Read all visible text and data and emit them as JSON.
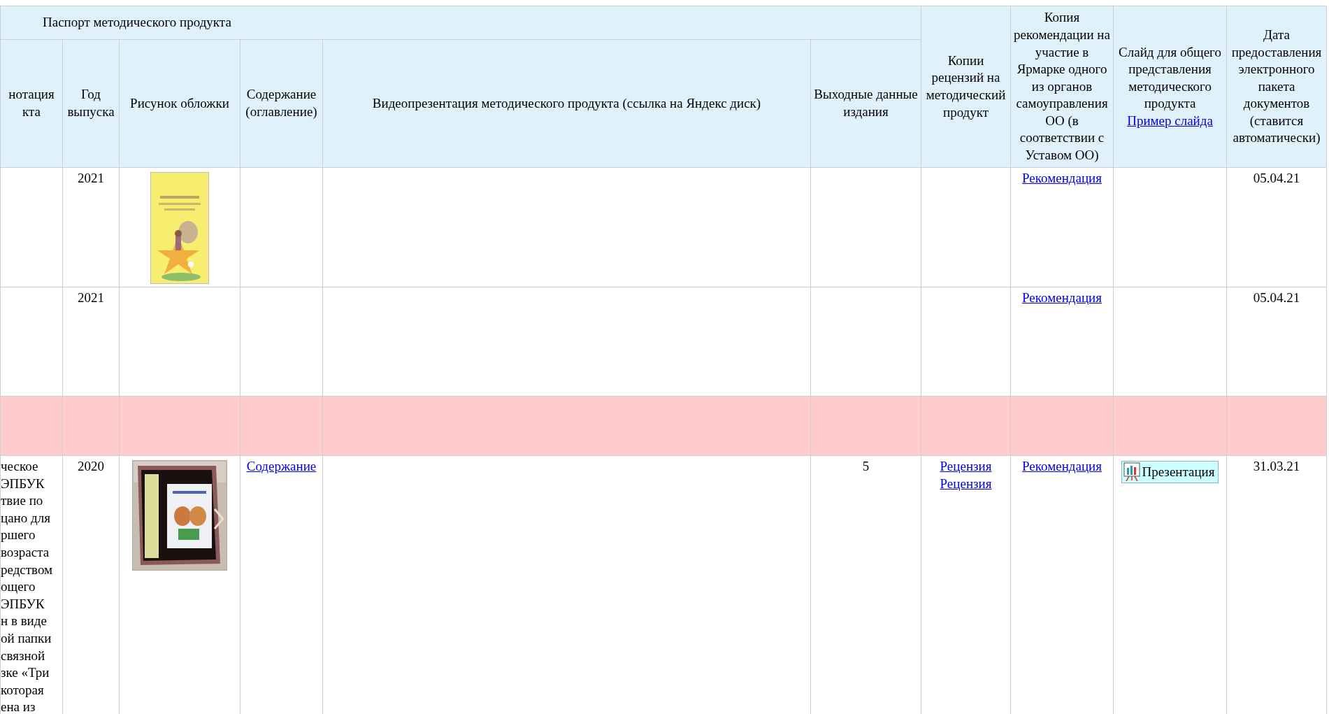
{
  "table": {
    "group_title": "Паспорт методического продукта",
    "columns": [
      {
        "label": "нотация\nкта"
      },
      {
        "label": "Год выпуска"
      },
      {
        "label": "Рисунок обложки"
      },
      {
        "label": "Содержание (оглавление)"
      },
      {
        "label": "Видеопрезентация методического продукта (ссылка на Яндекс диск)"
      },
      {
        "label": "Выходные данные издания"
      },
      {
        "label": "Копии рецензий на методический продукт"
      },
      {
        "label": "Копия рекомендации на участие в Ярмарке одного из органов самоуправления ОО (в соответствии с Уставом ОО)"
      },
      {
        "label": "Слайд для общего представления методического продукта",
        "link": "Пример слайда"
      },
      {
        "label": "Дата предоставления электронного пакета документов (ставится автоматически)"
      }
    ],
    "rows": [
      {
        "highlighted": false,
        "year": "2021",
        "recommendation": "Рекомендация",
        "date": "05.04.21"
      },
      {
        "highlighted": false,
        "year": "2021",
        "recommendation": "Рекомендация",
        "date": "05.04.21"
      },
      {
        "highlighted": true
      },
      {
        "highlighted": false,
        "annotation": "ческое\nЭПБУК\nтвие по\nцано для\nршего\nвозраста\nредством\nощего\nЭПБУК\nн в виде\nой папки\nсвязной\nзке «Три\nкоторая\nена из",
        "year": "2020",
        "contents": "Содержание",
        "output": "5",
        "reviews": [
          "Рецензия",
          "Рецензия"
        ],
        "recommendation": "Рекомендация",
        "slide": "Презентация",
        "date": "31.03.21"
      }
    ]
  }
}
